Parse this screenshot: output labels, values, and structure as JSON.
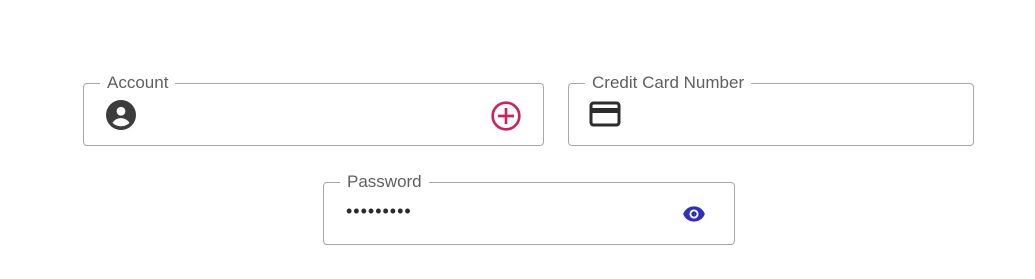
{
  "fields": {
    "account": {
      "label": "Account",
      "leading_icon": "account-circle-icon",
      "trailing_icon": "add-circle-outline-icon",
      "value": ""
    },
    "credit_card": {
      "label": "Credit Card Number",
      "leading_icon": "credit-card-icon",
      "value": ""
    },
    "password": {
      "label": "Password",
      "value": "•••••••••",
      "trailing_icon": "visibility-icon"
    }
  },
  "colors": {
    "border": "#a8a8a8",
    "label": "#5f5f5f",
    "icon_dark": "#3c3c3c",
    "add_accent": "#c9245f",
    "eye_accent": "#2f2fb8"
  }
}
